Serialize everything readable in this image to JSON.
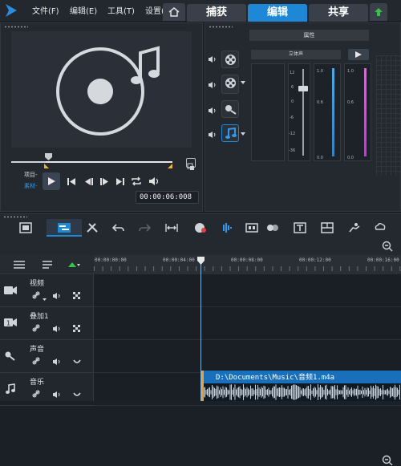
{
  "menu": {
    "items": [
      "文件(F)",
      "编辑(E)",
      "工具(T)",
      "设置("
    ]
  },
  "tabs": [
    {
      "label": "捕获",
      "active": false
    },
    {
      "label": "编辑",
      "active": true
    },
    {
      "label": "共享",
      "active": false
    }
  ],
  "preview": {
    "source_labels": {
      "project": "项目-",
      "clip": "素材-"
    },
    "timecode": "00:00:06:008"
  },
  "properties": {
    "title": "属性",
    "stereo_label": "立体声",
    "fader_scale": [
      "12",
      "6",
      "0",
      "-6",
      "-12",
      "-36"
    ],
    "meter_scale_left": [
      "1.0",
      "0.6",
      "0.0"
    ],
    "meter_scale_right": [
      "1.0",
      "0.6",
      "0.0"
    ]
  },
  "ruler": {
    "timecodes": [
      "00:00:00:00",
      "00:00:04:00",
      "00:00:08:00",
      "00:00:12:00",
      "00:00:16:00"
    ]
  },
  "tracks": [
    {
      "name": "视频",
      "icon": "video-track-icon"
    },
    {
      "name": "叠加1",
      "icon": "overlay-track-icon"
    },
    {
      "name": "声音",
      "icon": "voice-track-icon"
    },
    {
      "name": "音乐",
      "icon": "music-track-icon"
    }
  ],
  "clip": {
    "name": "D:\\Documents\\Music\\音频1.m4a"
  },
  "colors": {
    "accent": "#1e88d6",
    "clip": "#1a6fbb",
    "clip_edge": "#f0a030",
    "background": "#1b2027"
  }
}
